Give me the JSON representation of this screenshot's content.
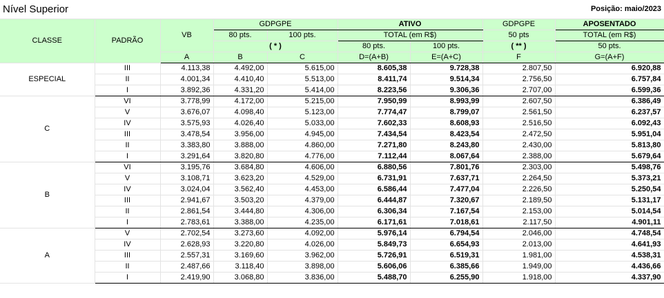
{
  "title": "Nível Superior",
  "position": "Posição: maio/2023",
  "headers": {
    "classe": "CLASSE",
    "padrao": "PADRÃO",
    "vb": "VB",
    "gdpgpe_ativo": "GDPGPE",
    "pts80": "80 pts.",
    "pts100": "100 pts.",
    "ativo": "ATIVO",
    "total_ativo": "TOTAL (em R$)",
    "gdpgpe_apos": "GDPGPE",
    "pts50": "50 pts",
    "aposentado": "APOSENTADO",
    "total_apos": "TOTAL (em R$)",
    "star1": "( * )",
    "star2": "( ** )",
    "ativo80": "80 pts.",
    "ativo100": "100 pts.",
    "apos50": "50 pts.",
    "colA": "A",
    "colB": "B",
    "colC": "C",
    "colD": "D=(A+B)",
    "colE": "E=(A+C)",
    "colF": "F",
    "colG": "G=(A+F)"
  },
  "groups": [
    {
      "classe": "ESPECIAL",
      "rows": [
        {
          "padrao": "III",
          "vb": "4.113,38",
          "b": "4.492,00",
          "c": "5.615,00",
          "d": "8.605,38",
          "e": "9.728,38",
          "f": "2.807,50",
          "g": "6.920,88"
        },
        {
          "padrao": "II",
          "vb": "4.001,34",
          "b": "4.410,40",
          "c": "5.513,00",
          "d": "8.411,74",
          "e": "9.514,34",
          "f": "2.756,50",
          "g": "6.757,84"
        },
        {
          "padrao": "I",
          "vb": "3.892,36",
          "b": "4.331,20",
          "c": "5.414,00",
          "d": "8.223,56",
          "e": "9.306,36",
          "f": "2.707,00",
          "g": "6.599,36"
        }
      ]
    },
    {
      "classe": "C",
      "rows": [
        {
          "padrao": "VI",
          "vb": "3.778,99",
          "b": "4.172,00",
          "c": "5.215,00",
          "d": "7.950,99",
          "e": "8.993,99",
          "f": "2.607,50",
          "g": "6.386,49"
        },
        {
          "padrao": "V",
          "vb": "3.676,07",
          "b": "4.098,40",
          "c": "5.123,00",
          "d": "7.774,47",
          "e": "8.799,07",
          "f": "2.561,50",
          "g": "6.237,57"
        },
        {
          "padrao": "IV",
          "vb": "3.575,93",
          "b": "4.026,40",
          "c": "5.033,00",
          "d": "7.602,33",
          "e": "8.608,93",
          "f": "2.516,50",
          "g": "6.092,43"
        },
        {
          "padrao": "III",
          "vb": "3.478,54",
          "b": "3.956,00",
          "c": "4.945,00",
          "d": "7.434,54",
          "e": "8.423,54",
          "f": "2.472,50",
          "g": "5.951,04"
        },
        {
          "padrao": "II",
          "vb": "3.383,80",
          "b": "3.888,00",
          "c": "4.860,00",
          "d": "7.271,80",
          "e": "8.243,80",
          "f": "2.430,00",
          "g": "5.813,80"
        },
        {
          "padrao": "I",
          "vb": "3.291,64",
          "b": "3.820,80",
          "c": "4.776,00",
          "d": "7.112,44",
          "e": "8.067,64",
          "f": "2.388,00",
          "g": "5.679,64"
        }
      ]
    },
    {
      "classe": "B",
      "rows": [
        {
          "padrao": "VI",
          "vb": "3.195,76",
          "b": "3.684,80",
          "c": "4.606,00",
          "d": "6.880,56",
          "e": "7.801,76",
          "f": "2.303,00",
          "g": "5.498,76"
        },
        {
          "padrao": "V",
          "vb": "3.108,71",
          "b": "3.623,20",
          "c": "4.529,00",
          "d": "6.731,91",
          "e": "7.637,71",
          "f": "2.264,50",
          "g": "5.373,21"
        },
        {
          "padrao": "IV",
          "vb": "3.024,04",
          "b": "3.562,40",
          "c": "4.453,00",
          "d": "6.586,44",
          "e": "7.477,04",
          "f": "2.226,50",
          "g": "5.250,54"
        },
        {
          "padrao": "III",
          "vb": "2.941,67",
          "b": "3.503,20",
          "c": "4.379,00",
          "d": "6.444,87",
          "e": "7.320,67",
          "f": "2.189,50",
          "g": "5.131,17"
        },
        {
          "padrao": "II",
          "vb": "2.861,54",
          "b": "3.444,80",
          "c": "4.306,00",
          "d": "6.306,34",
          "e": "7.167,54",
          "f": "2.153,00",
          "g": "5.014,54"
        },
        {
          "padrao": "I",
          "vb": "2.783,61",
          "b": "3.388,00",
          "c": "4.235,00",
          "d": "6.171,61",
          "e": "7.018,61",
          "f": "2.117,50",
          "g": "4.901,11"
        }
      ]
    },
    {
      "classe": "A",
      "rows": [
        {
          "padrao": "V",
          "vb": "2.702,54",
          "b": "3.273,60",
          "c": "4.092,00",
          "d": "5.976,14",
          "e": "6.794,54",
          "f": "2.046,00",
          "g": "4.748,54"
        },
        {
          "padrao": "IV",
          "vb": "2.628,93",
          "b": "3.220,80",
          "c": "4.026,00",
          "d": "5.849,73",
          "e": "6.654,93",
          "f": "2.013,00",
          "g": "4.641,93"
        },
        {
          "padrao": "III",
          "vb": "2.557,31",
          "b": "3.169,60",
          "c": "3.962,00",
          "d": "5.726,91",
          "e": "6.519,31",
          "f": "1.981,00",
          "g": "4.538,31"
        },
        {
          "padrao": "II",
          "vb": "2.487,66",
          "b": "3.118,40",
          "c": "3.898,00",
          "d": "5.606,06",
          "e": "6.385,66",
          "f": "1.949,00",
          "g": "4.436,66"
        },
        {
          "padrao": "I",
          "vb": "2.419,90",
          "b": "3.068,80",
          "c": "3.836,00",
          "d": "5.488,70",
          "e": "6.255,90",
          "f": "1.918,00",
          "g": "4.337,90"
        }
      ]
    }
  ]
}
